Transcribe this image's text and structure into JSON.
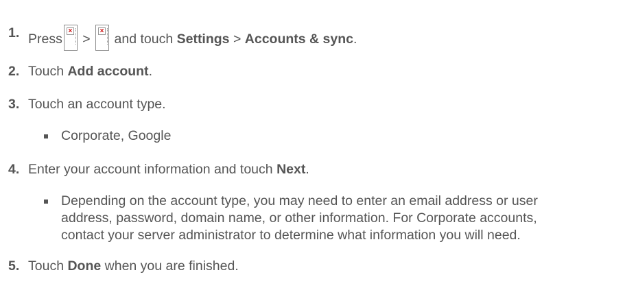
{
  "steps": [
    {
      "num": "1.",
      "pre": "Press",
      "sep": ">",
      "mid": "and touch",
      "b1": "Settings",
      "arrow": ">",
      "b2": "Accounts & sync",
      "end": "."
    },
    {
      "num": "2.",
      "pre": "Touch",
      "b1": "Add account",
      "end": "."
    },
    {
      "num": "3.",
      "text": "Touch an account type."
    },
    {
      "num": "4.",
      "pre": "Enter your account information and touch",
      "b1": "Next",
      "end": "."
    },
    {
      "num": "5.",
      "pre": "Touch",
      "b1": "Done",
      "post": "when you are finished."
    }
  ],
  "bullets": {
    "b3": "Corporate, Google",
    "b4_lines": [
      "Depending on the account type, you may need to enter an email address or user",
      "address, password, domain name, or other information. For Corporate accounts,",
      "contact your server administrator to determine what information you will need."
    ]
  },
  "icons": [
    "menu-key-icon",
    "menu-key-icon"
  ]
}
